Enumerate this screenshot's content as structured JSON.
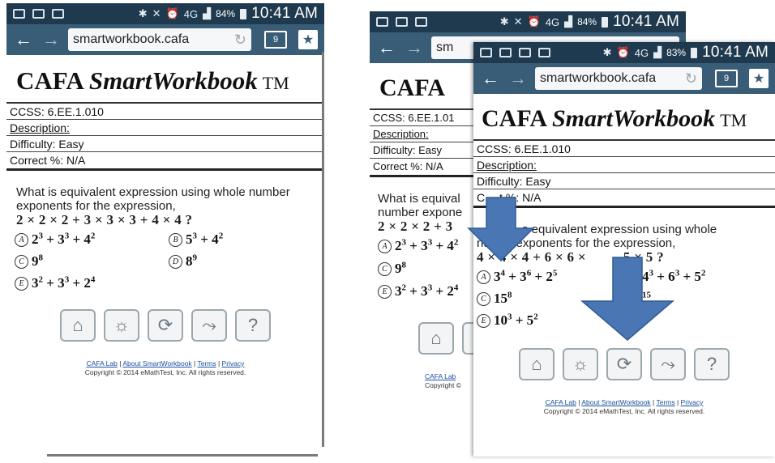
{
  "status": {
    "time": "10:41 AM",
    "battery_a": "84%",
    "battery_c": "83%",
    "network": "4G"
  },
  "browser": {
    "url": "smartworkbook.cafa",
    "url_partial": "sm",
    "tabs_count": "9"
  },
  "brand": {
    "prefix": "CAFA ",
    "smart": "Smart",
    "workbook_w": "W",
    "workbook_rest": "orkbook",
    "tm": "TM",
    "partial": "CAFA"
  },
  "meta": {
    "ccss": "CCSS: 6.EE.1.010",
    "ccss_partial": "CCSS: 6.EE.1.01",
    "description": "Description:",
    "difficulty": "Difficulty: Easy",
    "correct": "Correct %: N/A",
    "correct_partial": "C",
    "correct_tail": "t %: N/A"
  },
  "question_a": {
    "text": "What is equivalent expression using whole number exponents for the expression,",
    "expr": "2 × 2 × 2 + 3 × 3 × 3 + 4 × 4 ?",
    "partial_line1": "What is equival",
    "partial_line2": "number expone",
    "partial_expr": "2 × 2 × 2 + 3"
  },
  "choices_a": [
    {
      "letter": "A",
      "base": "2",
      "exp": "3",
      "rest1": " + 3",
      "exp2": "3",
      "rest2": " + 4",
      "exp3": "2"
    },
    {
      "letter": "B",
      "base": "5",
      "exp": "3",
      "rest1": " + 4",
      "exp2": "2"
    },
    {
      "letter": "C",
      "base": "9",
      "exp": "8"
    },
    {
      "letter": "D",
      "base": "8",
      "exp": "9"
    },
    {
      "letter": "E",
      "base": "3",
      "exp": "2",
      "rest1": " + 3",
      "exp2": "3",
      "rest2": " + 2",
      "exp3": "4"
    }
  ],
  "question_c": {
    "line1_tail": "s equivalent expression using whole",
    "line2_head": "nu",
    "line2_tail": "ber exponents for the expression,",
    "expr_head": "4 × 4 × 4 + 6 × 6 ×",
    "expr_tail": "5 × 5 ?"
  },
  "choices_c": [
    {
      "letter": "A",
      "base": "3",
      "exp": "4",
      "rest1": " + 3",
      "exp2": "6",
      "rest2": " + 2",
      "exp3": "5"
    },
    {
      "letter": "B",
      "base": "4",
      "exp": "3",
      "rest1": " + 6",
      "exp2": "3",
      "rest2": " + 5",
      "exp3": "2"
    },
    {
      "letter": "C",
      "base": "15",
      "exp": "8"
    },
    {
      "letter": "D",
      "base": "",
      "exp": "15"
    },
    {
      "letter": "E",
      "base": "10",
      "exp": "3",
      "rest1": " + 5",
      "exp2": "2"
    }
  ],
  "toolbar": {
    "home": "home-icon",
    "hint": "lightbulb-icon",
    "refresh": "refresh-icon",
    "next": "next-arrow-icon",
    "help": "?"
  },
  "footer": {
    "link1": "CAFA Lab",
    "sep": " | ",
    "link2": "About SmartWorkbook",
    "link3": "Terms",
    "link4": "Privacy",
    "copyright": "Copyright © 2014 eMathTest, Inc. All rights reserved.",
    "link1_partial": "CAFA Lab",
    "copyright_partial": "Copyright ©"
  },
  "colors": {
    "status_bg": "#1f3a4e",
    "urlbar_bg": "#3a5d77",
    "arrow_blue": "#4a77b4"
  }
}
